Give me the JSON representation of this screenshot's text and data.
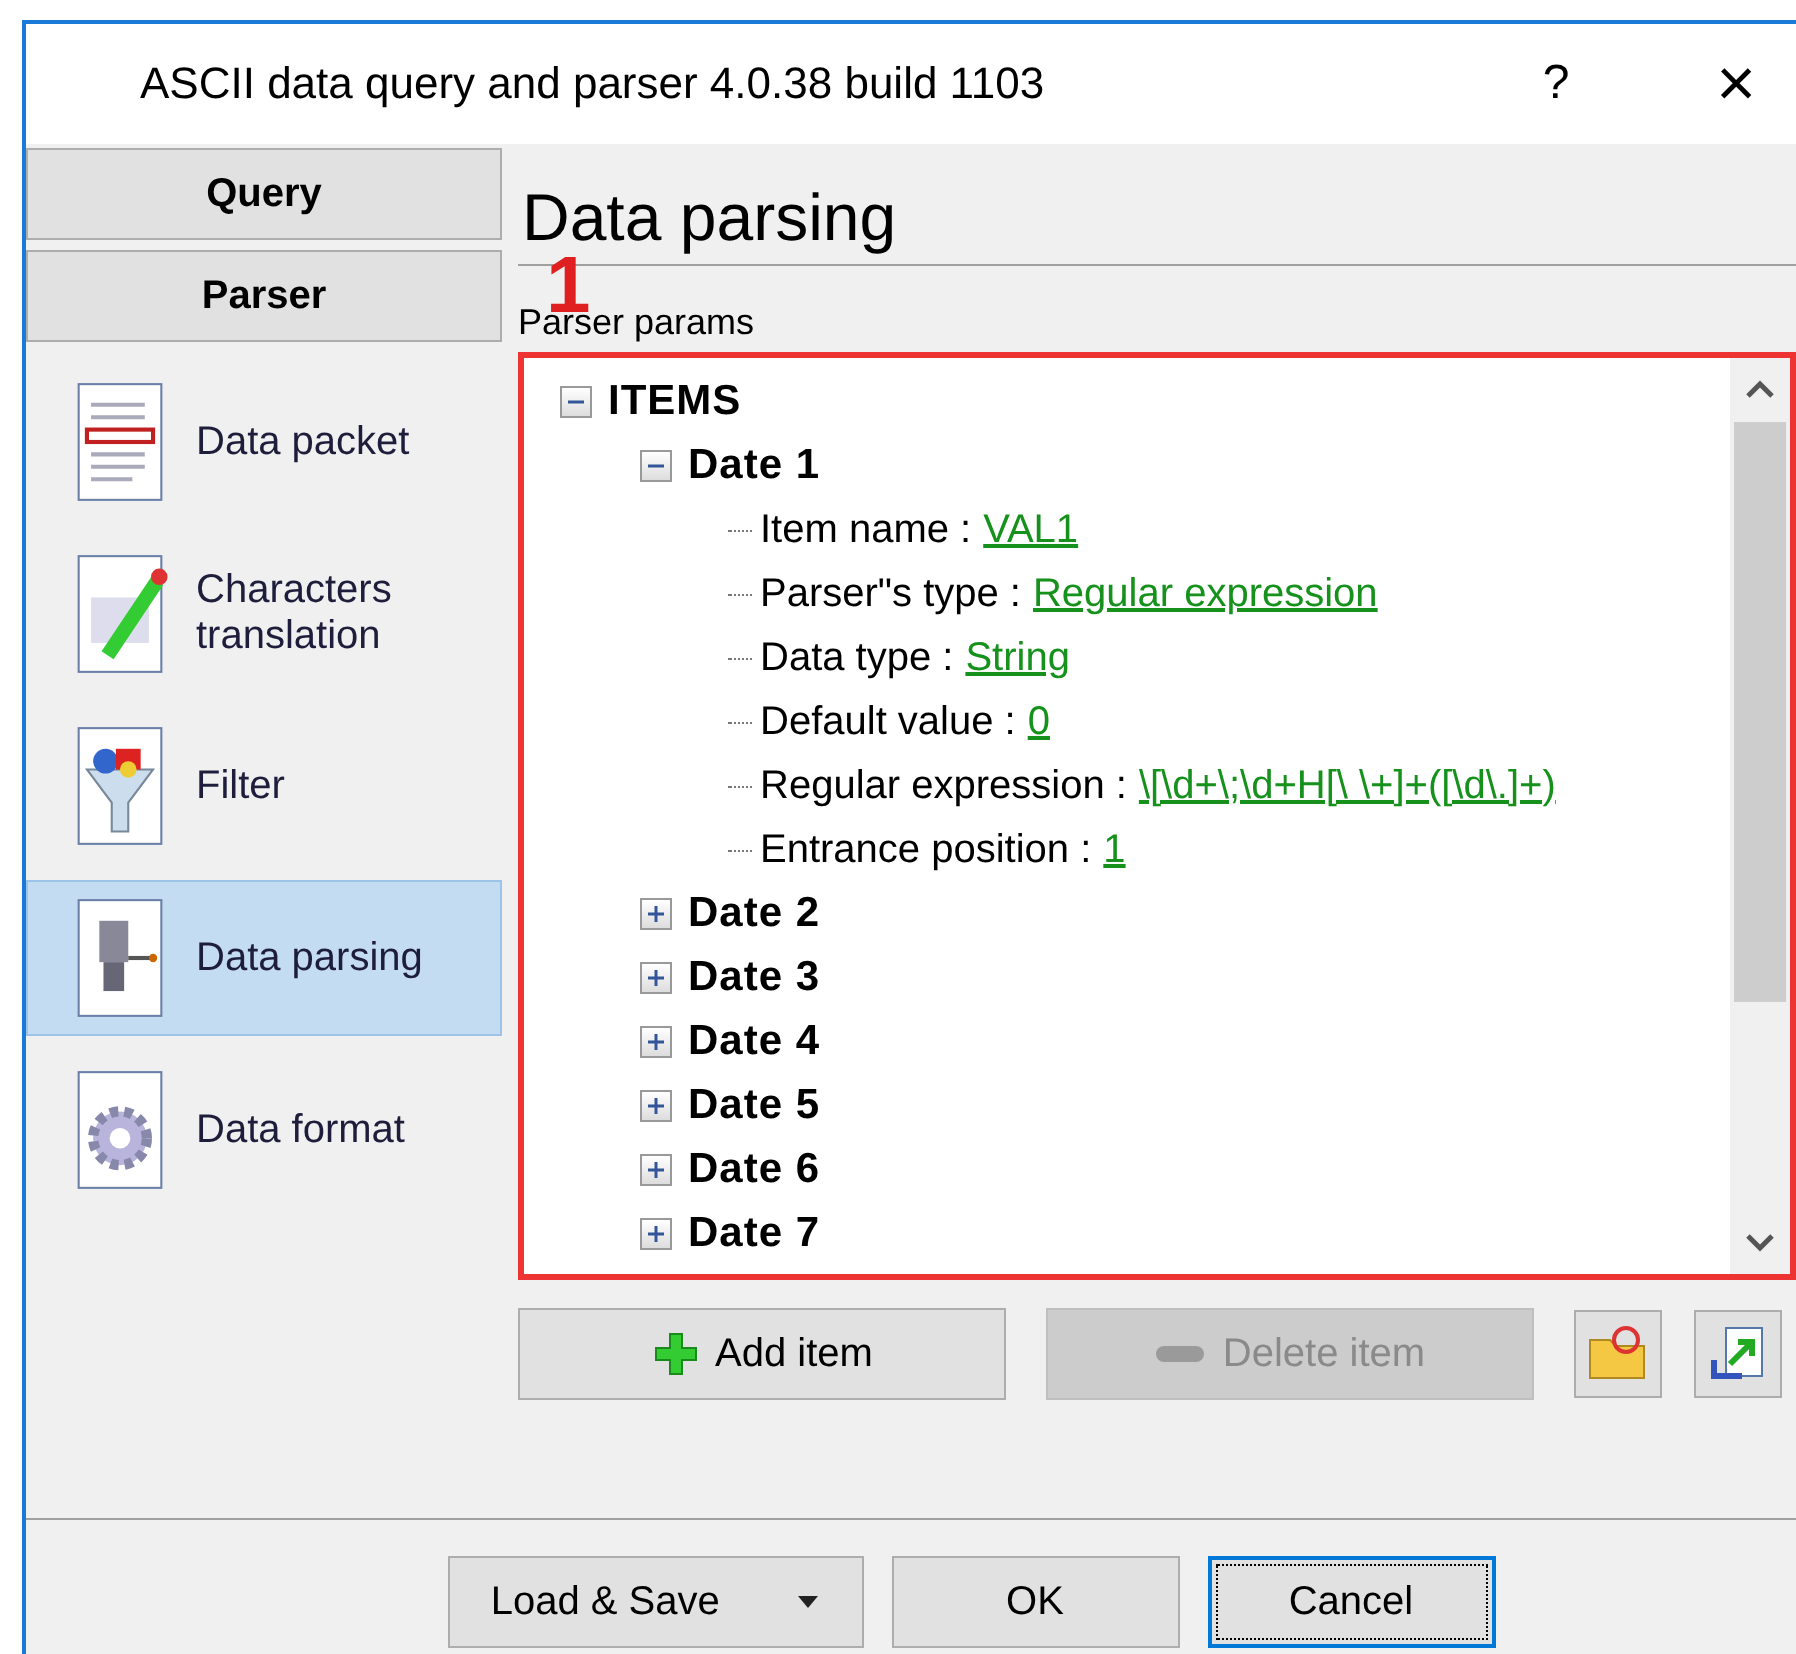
{
  "window": {
    "title": "ASCII data query and parser 4.0.38 build 1103",
    "help": "?",
    "close": "×"
  },
  "nav": {
    "sections": [
      {
        "label": "Query"
      },
      {
        "label": "Parser"
      }
    ],
    "items": [
      {
        "label": "Data packet",
        "selected": false
      },
      {
        "label": "Characters translation",
        "selected": false
      },
      {
        "label": "Filter",
        "selected": false
      },
      {
        "label": "Data parsing",
        "selected": true
      },
      {
        "label": "Data format",
        "selected": false
      }
    ]
  },
  "page": {
    "heading": "Data parsing",
    "group_label": "Parser params",
    "annotation": "1"
  },
  "tree": {
    "label": "ITEMS",
    "expanded": true,
    "children": [
      {
        "label": "Date 1",
        "expanded": true,
        "children": [
          {
            "name": "Item name :",
            "value": "VAL1"
          },
          {
            "name": "Parser\"s type :",
            "value": "Regular expression"
          },
          {
            "name": "Data type :",
            "value": "String"
          },
          {
            "name": "Default value :",
            "value": "0"
          },
          {
            "name": "Regular expression :",
            "value": "\\[\\d+\\;\\d+H[\\ \\+]+([\\d\\.]+)"
          },
          {
            "name": "Entrance position :",
            "value": "1"
          }
        ]
      },
      {
        "label": "Date 2",
        "expanded": false
      },
      {
        "label": "Date 3",
        "expanded": false
      },
      {
        "label": "Date 4",
        "expanded": false
      },
      {
        "label": "Date 5",
        "expanded": false
      },
      {
        "label": "Date 6",
        "expanded": false
      },
      {
        "label": "Date 7",
        "expanded": false
      }
    ]
  },
  "actions": [
    {
      "label": "Add item",
      "disabled": false
    },
    {
      "label": "Delete item",
      "disabled": true
    }
  ],
  "footer": [
    {
      "label": "Load & Save",
      "dropdown": true,
      "focused": false
    },
    {
      "label": "OK",
      "dropdown": false,
      "focused": false
    },
    {
      "label": "Cancel",
      "dropdown": false,
      "focused": true
    }
  ]
}
